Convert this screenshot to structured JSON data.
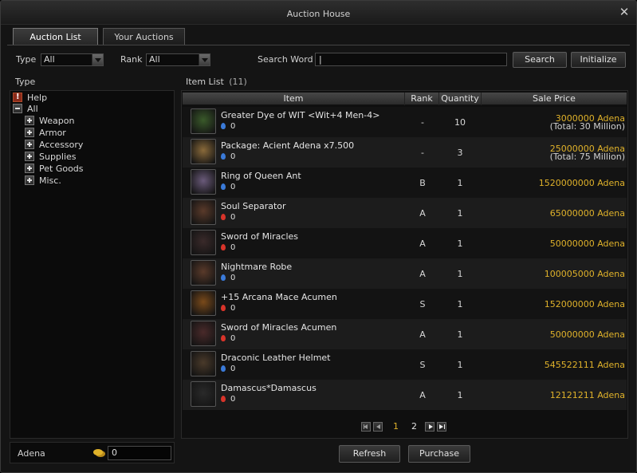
{
  "window": {
    "title": "Auction House"
  },
  "tabs": [
    {
      "label": "Auction List",
      "active": true
    },
    {
      "label": "Your Auctions",
      "active": false
    }
  ],
  "filters": {
    "type_label": "Type",
    "type_value": "All",
    "rank_label": "Rank",
    "rank_value": "All",
    "search_label": "Search Word",
    "search_value": "",
    "search_button": "Search",
    "initialize_button": "Initialize"
  },
  "sidebar": {
    "heading": "Type",
    "items": [
      {
        "label": "Help",
        "icon": "help-icon",
        "level": 0
      },
      {
        "label": "All",
        "icon": "collapse-icon",
        "level": 0
      },
      {
        "label": "Weapon",
        "icon": "expand-icon",
        "level": 1
      },
      {
        "label": "Armor",
        "icon": "expand-icon",
        "level": 1
      },
      {
        "label": "Accessory",
        "icon": "expand-icon",
        "level": 1
      },
      {
        "label": "Supplies",
        "icon": "expand-icon",
        "level": 1
      },
      {
        "label": "Pet Goods",
        "icon": "expand-icon",
        "level": 1
      },
      {
        "label": "Misc.",
        "icon": "expand-icon",
        "level": 1
      }
    ]
  },
  "list": {
    "heading": "Item List",
    "count": "(11)",
    "columns": [
      "Item",
      "Rank",
      "Quantity",
      "Sale Price"
    ],
    "rows": [
      {
        "name": "Greater Dye of WIT <Wit+4 Men-4>",
        "attr": "water",
        "enchant": "0",
        "rank": "-",
        "quantity": "10",
        "price": "3000000 Adena",
        "total": "(Total: 30 Million)",
        "icon_color": "#3a5a2a"
      },
      {
        "name": "Package: Acient Adena x7.500",
        "attr": "water",
        "enchant": "0",
        "rank": "-",
        "quantity": "3",
        "price": "25000000 Adena",
        "total": "(Total: 75 Million)",
        "icon_color": "#8a6a3a"
      },
      {
        "name": "Ring of Queen Ant",
        "attr": "water",
        "enchant": "0",
        "rank": "B",
        "quantity": "1",
        "price": "1520000000 Adena",
        "total": "",
        "icon_color": "#6a5a7a"
      },
      {
        "name": "Soul Separator",
        "attr": "fire",
        "enchant": "0",
        "rank": "A",
        "quantity": "1",
        "price": "65000000 Adena",
        "total": "",
        "icon_color": "#5a3a2a"
      },
      {
        "name": "Sword of Miracles",
        "attr": "fire",
        "enchant": "0",
        "rank": "A",
        "quantity": "1",
        "price": "50000000 Adena",
        "total": "",
        "icon_color": "#3a2a2a"
      },
      {
        "name": "Nightmare Robe",
        "attr": "water",
        "enchant": "0",
        "rank": "A",
        "quantity": "1",
        "price": "100005000 Adena",
        "total": "",
        "icon_color": "#5a3a2a"
      },
      {
        "name": "+15 Arcana Mace Acumen",
        "attr": "fire",
        "enchant": "0",
        "rank": "S",
        "quantity": "1",
        "price": "152000000 Adena",
        "total": "",
        "icon_color": "#7a4a1a"
      },
      {
        "name": "Sword of Miracles Acumen",
        "attr": "fire",
        "enchant": "0",
        "rank": "A",
        "quantity": "1",
        "price": "50000000 Adena",
        "total": "",
        "icon_color": "#4a2a2a"
      },
      {
        "name": "Draconic Leather Helmet",
        "attr": "water",
        "enchant": "0",
        "rank": "S",
        "quantity": "1",
        "price": "545522111 Adena",
        "total": "",
        "icon_color": "#4a3a2a"
      },
      {
        "name": "Damascus*Damascus",
        "attr": "fire",
        "enchant": "0",
        "rank": "A",
        "quantity": "1",
        "price": "12121211 Adena",
        "total": "",
        "icon_color": "#2a2a2a"
      }
    ]
  },
  "pagination": {
    "pages": [
      "1",
      "2"
    ],
    "current": "1"
  },
  "footer": {
    "adena_label": "Adena",
    "adena_value": "0",
    "refresh_button": "Refresh",
    "purchase_button": "Purchase"
  },
  "colors": {
    "price": "#e0b22a",
    "water": "#3a7ad8",
    "fire": "#d8342a"
  }
}
